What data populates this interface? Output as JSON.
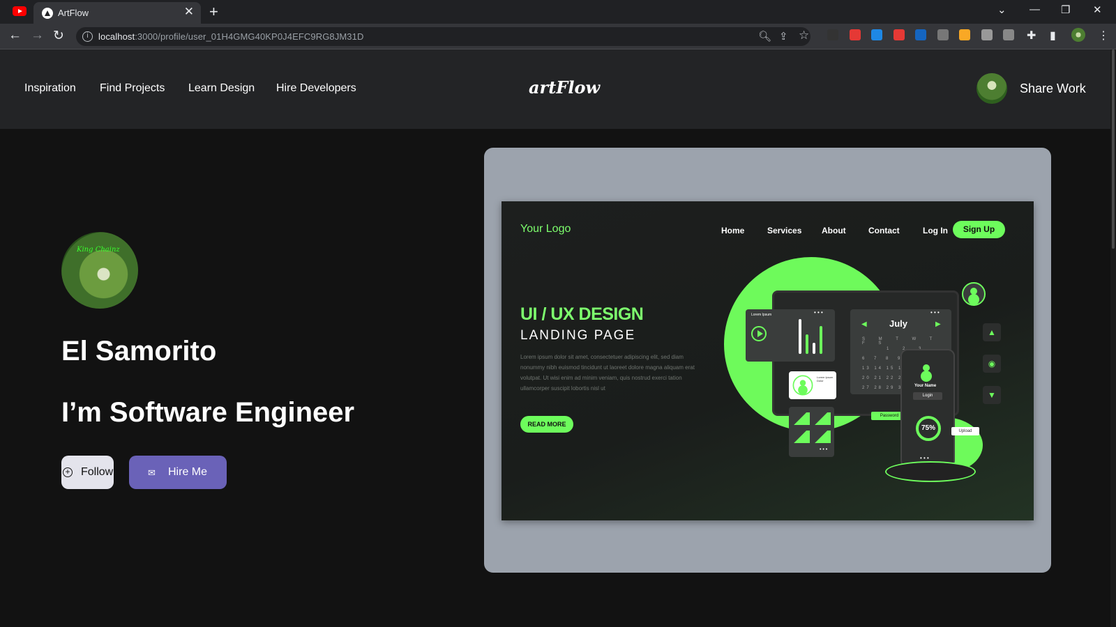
{
  "browser": {
    "tab_title": "ArtFlow",
    "tab_close": "✕",
    "new_tab": "+",
    "url_host": "localhost",
    "url_path": ":3000/profile/user_01H4GMG40KP0J4EFC9RG8JM31D",
    "window_controls": [
      "⌄",
      "—",
      "❐",
      "✕"
    ],
    "nav": {
      "back": "←",
      "forward": "→",
      "reload": "↻"
    },
    "icons": {
      "zoom": "🔍︎",
      "share": "⇪",
      "bookmark": "☆",
      "extensions": "✚",
      "sidepanel": "▮",
      "menu": "⋮"
    },
    "extension_colors": [
      "#333333",
      "#e53935",
      "#1e88e5",
      "#e53935",
      "#1565c0",
      "#777777",
      "#f9a825",
      "#999999",
      "#888888"
    ]
  },
  "header": {
    "nav_links": [
      "Inspiration",
      "Find Projects",
      "Learn Design",
      "Hire Developers"
    ],
    "logo": "artFlow",
    "share_work": "Share Work"
  },
  "profile": {
    "avatar_caption": "King Chainz",
    "name": "El Samorito",
    "role": "I’m Software Engineer",
    "follow_label": "Follow",
    "follow_icon": "+",
    "hire_label": "Hire Me",
    "hire_icon": "✉"
  },
  "project": {
    "logo": "Your Logo",
    "nav": [
      "Home",
      "Services",
      "About",
      "Contact",
      "Log In"
    ],
    "signup": "Sign Up",
    "headline": "UI / UX DESIGN",
    "subhead": "LANDING PAGE",
    "lorem": "Lorem ipsum dolor sit amet, consectetuer adipiscing elit, sed diam nonummy nibh euismod tincidunt ut laoreet dolore magna aliquam erat volutpat. Ut wisi enim ad minim veniam, quis nostrud exerci tation ullamcorper suscipit lobortis nisl ut",
    "read_more": "READ MORE",
    "calendar_month": "July",
    "calendar_days": "S M T W T F S",
    "calendar_rows": [
      "1 2 3",
      "6 7 8 9 10",
      "13 14 15 16 17",
      "20 21 22 23 24",
      "27 28 29 30 31"
    ],
    "widget_label": "Lorem Ipsum",
    "profile_card_label": "Lorem Ipsum Dolor",
    "phone_name": "Your Name",
    "phone_login": "Login",
    "password_label": "Password",
    "progress": "75%",
    "upload": "Upload",
    "side_arrows": [
      "▲",
      "◉",
      "▼"
    ],
    "cal_arrows": [
      "◀",
      "▶"
    ],
    "dots": "• • •",
    "accent": "#6dfc5c"
  }
}
